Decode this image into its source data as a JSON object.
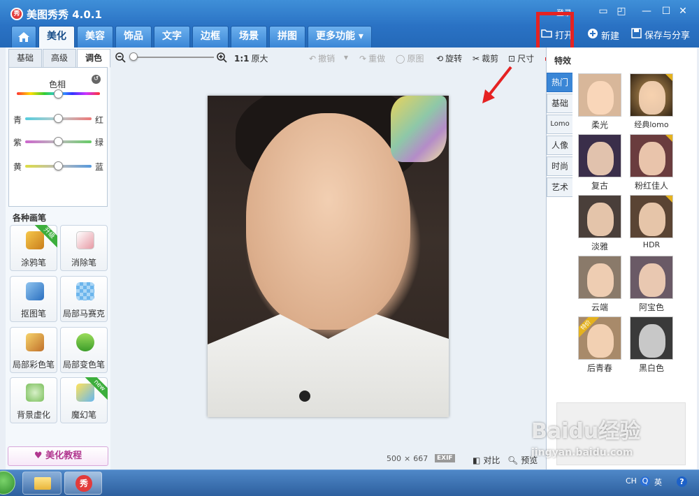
{
  "window": {
    "title": "美图秀秀 4.0.1",
    "app_icon_text": "秀",
    "login": "登录"
  },
  "main_tabs": [
    "美化",
    "美容",
    "饰品",
    "文字",
    "边框",
    "场景",
    "拼图",
    "更多功能"
  ],
  "header_actions": {
    "open": "打开",
    "new": "新建",
    "save_share": "保存与分享"
  },
  "sub_tabs": [
    "基础",
    "高级",
    "调色"
  ],
  "adjust": {
    "hue_label": "色相",
    "rows": [
      {
        "left": "青",
        "right": "红"
      },
      {
        "left": "紫",
        "right": "绿"
      },
      {
        "left": "黄",
        "right": "蓝"
      }
    ]
  },
  "brushes": {
    "title": "各种画笔",
    "items": [
      {
        "label": "涂鸦笔",
        "ribbon": "升级"
      },
      {
        "label": "消除笔"
      },
      {
        "label": "抠图笔"
      },
      {
        "label": "局部马赛克"
      },
      {
        "label": "局部彩色笔"
      },
      {
        "label": "局部变色笔"
      },
      {
        "label": "背景虚化"
      },
      {
        "label": "魔幻笔",
        "ribbon": "new"
      }
    ]
  },
  "tutorial": "美化教程",
  "toolbar": {
    "zoom_ratio": "1:1",
    "original_size": "原大",
    "undo": "撤销",
    "redo": "重做",
    "original_image": "原图",
    "rotate": "旋转",
    "crop": "裁剪",
    "size": "尺寸"
  },
  "status": {
    "width": "500",
    "times": "×",
    "height": "667",
    "exif": "EXIF",
    "compare": "对比",
    "preview": "预览"
  },
  "effects": {
    "title": "特效",
    "categories": [
      "热门",
      "基础",
      "Lomo",
      "人像",
      "时尚",
      "艺术"
    ],
    "items": [
      "柔光",
      "经典lomo",
      "复古",
      "粉红佳人",
      "淡雅",
      "HDR",
      "云端",
      "阿宝色",
      "后青春",
      "黑白色"
    ],
    "badge": "特价"
  },
  "taskbar": {
    "app_label": "秀",
    "lang": "CH",
    "ime": "英"
  },
  "watermark": {
    "brand": "Baidu经验",
    "site": "jingyan.baidu.com"
  },
  "colors": {
    "accent": "#3a86d6",
    "highlight": "#e52222",
    "title_bar": "#2a72c4"
  }
}
